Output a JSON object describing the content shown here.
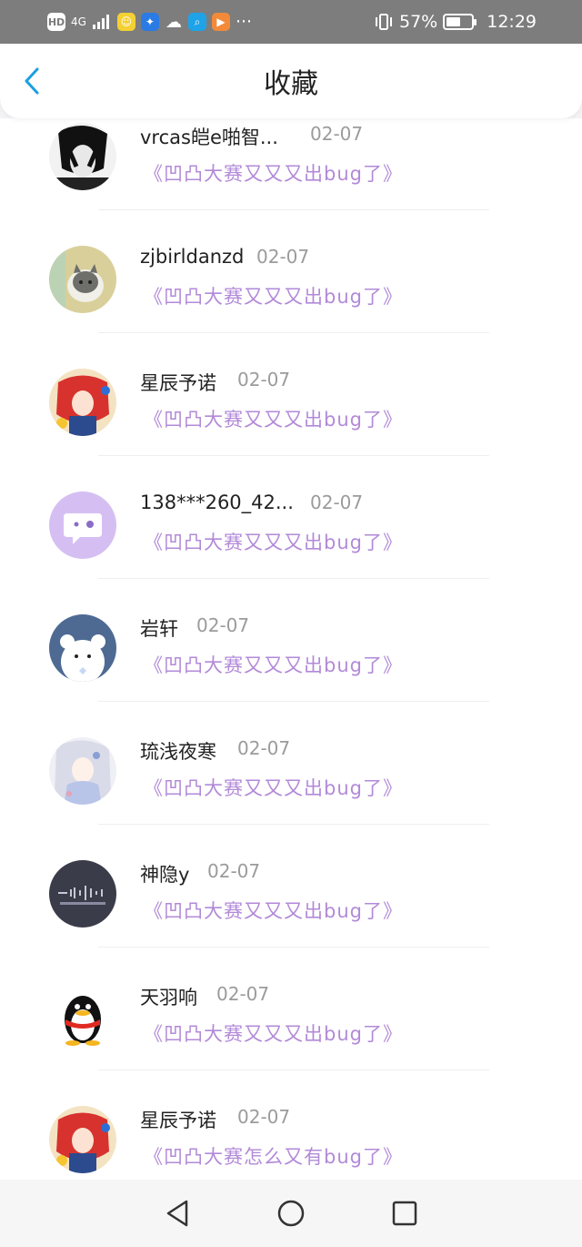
{
  "status": {
    "hd": "HD",
    "net": "4G",
    "battery_pct": "57%",
    "battery_level": 0.57,
    "time": "12:29",
    "dots": "···"
  },
  "header": {
    "title": "收藏"
  },
  "items": [
    {
      "name": "vrcas皑e啪智...",
      "date": "02-07",
      "ref": "《凹凸大赛又又又出bug了》",
      "avatar": "avatar-dark-portrait"
    },
    {
      "name": "zjbirldanzd",
      "date": "02-07",
      "ref": "《凹凸大赛又又又出bug了》",
      "avatar": "avatar-cat"
    },
    {
      "name": "星辰予诺",
      "date": "02-07",
      "ref": "《凹凸大赛又又又出bug了》",
      "avatar": "avatar-anime-red"
    },
    {
      "name": "138***260_42...",
      "date": "02-07",
      "ref": "《凹凸大赛又又又出bug了》",
      "avatar": "avatar-chat-bubble"
    },
    {
      "name": "岩轩",
      "date": "02-07",
      "ref": "《凹凸大赛又又又出bug了》",
      "avatar": "avatar-bear"
    },
    {
      "name": "琉浅夜寒",
      "date": "02-07",
      "ref": "《凹凸大赛又又又出bug了》",
      "avatar": "avatar-anime-white"
    },
    {
      "name": "神隐y",
      "date": "02-07",
      "ref": "《凹凸大赛又又又出bug了》",
      "avatar": "avatar-dark-wave"
    },
    {
      "name": "天羽响",
      "date": "02-07",
      "ref": "《凹凸大赛又又又出bug了》",
      "avatar": "avatar-penguin"
    },
    {
      "name": "星辰予诺",
      "date": "02-07",
      "ref": "《凹凸大赛怎么又有bug了》",
      "avatar": "avatar-anime-red"
    }
  ],
  "colors": {
    "accent": "#1aa0e0",
    "ref_text": "#b28ad8",
    "date_text": "#9b9b9b"
  }
}
